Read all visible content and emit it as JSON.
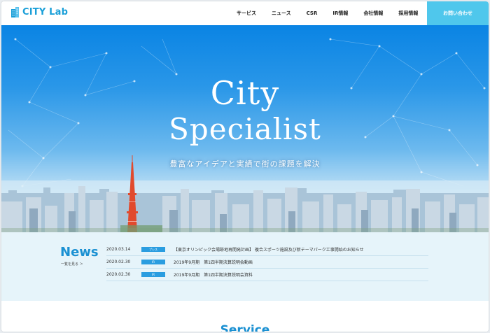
{
  "logo": {
    "text": "CITY Lab"
  },
  "nav": {
    "items": [
      {
        "label": "サービス"
      },
      {
        "label": "ニュース"
      },
      {
        "label": "CSR"
      },
      {
        "label": "IR情報"
      },
      {
        "label": "会社情報"
      },
      {
        "label": "採用情報"
      }
    ],
    "contact_label": "お問い合わせ"
  },
  "hero": {
    "title_line1": "City",
    "title_line2": "Specialist",
    "subtitle": "豊富なアイデアと実績で街の課題を解決"
  },
  "news": {
    "title": "News",
    "more_label": "一覧を見る ＞",
    "items": [
      {
        "date": "2020.03.14",
        "badge": "プレス",
        "text": "【東京オリンピック会場跡地再開発計画】 複合スポーツ施設及び新テーマパーク工事開始のお知らせ"
      },
      {
        "date": "2020.02.30",
        "badge": "IR",
        "text": "2019年9月期　第1四半期決算説明会動画"
      },
      {
        "date": "2020.02.30",
        "badge": "IR",
        "text": "2019年9月期　第1四半期決算説明会資料"
      }
    ]
  },
  "service": {
    "title": "Service"
  },
  "colors": {
    "accent": "#1a90d2",
    "contact_bg": "#4fc7ec",
    "news_bg": "#e6f4fa",
    "badge": "#2a9de0"
  },
  "icons": {
    "logo": "building-icon"
  }
}
